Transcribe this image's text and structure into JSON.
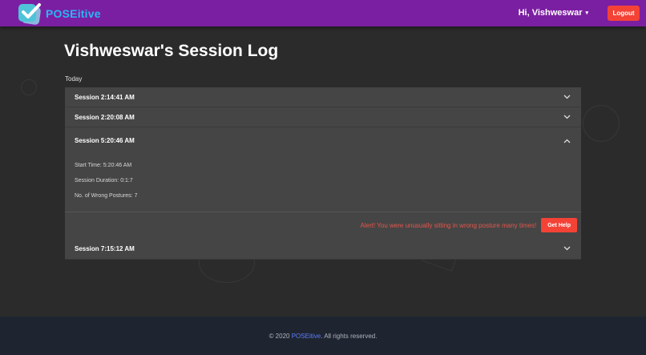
{
  "navbar": {
    "brand_name": "POSEitive",
    "user_greeting": "Hi, Vishweswar",
    "user_caret": "▾",
    "logout_label": "Logout"
  },
  "page": {
    "title": "Vishweswar's Session Log",
    "day_label": "Today"
  },
  "sessions": [
    {
      "label": "Session 2:14:41 AM"
    },
    {
      "label": "Session 2:20:08 AM"
    },
    {
      "label": "Session 5:20:46 AM",
      "details": {
        "start_time": "Start Time: 5:20:46 AM",
        "duration": "Session Duration: 0:1:7",
        "wrong_postures": "No. of Wrong Postures: 7"
      },
      "alert": "Alert! You were unusually sitting in wrong posture many times!",
      "help_label": "Get Help"
    },
    {
      "label": "Session 7:15:12 AM"
    }
  ],
  "footer": {
    "copyright_prefix": "© 2020",
    "brand_link": "POSEitive",
    "copyright_suffix": ". All rights reserved."
  },
  "colors": {
    "navbar": "#7b1fa2",
    "brand": "#29b6f6",
    "logout": "#f44336",
    "alert": "#e5564b",
    "panel": "#454545",
    "background": "#2b2b2b",
    "footer": "#1e2531"
  },
  "icons": {
    "logo": "checkmark-logo-icon",
    "collapsed": "chevron-down-icon",
    "expanded": "chevron-up-icon"
  }
}
